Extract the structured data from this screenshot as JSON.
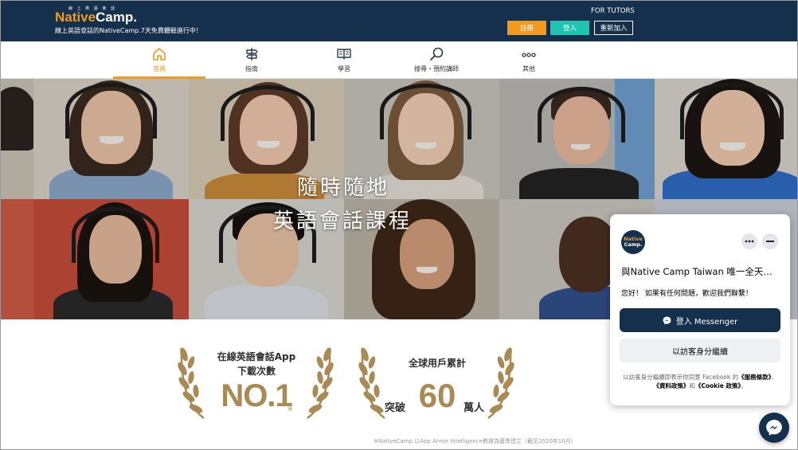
{
  "header": {
    "logo_small": "線 上 英 語 會 話",
    "logo_native": "Native",
    "logo_camp": "Camp.",
    "tagline": "線上英語會話的NativeCamp.7天免費體驗進行中！",
    "for_tutors": "FOR TUTORS",
    "register_label": "註冊",
    "login_label": "登入",
    "rejoin_label": "重新加入",
    "colors": {
      "navy": "#14304d",
      "orange": "#f39a1e",
      "teal": "#21c4b1"
    }
  },
  "nav": {
    "items": [
      {
        "label": "首頁",
        "icon": "home-icon",
        "active": true
      },
      {
        "label": "指南",
        "icon": "signpost-icon",
        "active": false
      },
      {
        "label": "學習",
        "icon": "book-icon",
        "active": false
      },
      {
        "label": "搜尋・預約講師",
        "icon": "search-icon",
        "active": false
      },
      {
        "label": "其他",
        "icon": "more-dots-icon",
        "active": false
      }
    ]
  },
  "hero": {
    "line1": "隨時隨地",
    "line2": "英語會話課程"
  },
  "awards": {
    "app": {
      "line1": "在線英語會話App",
      "line2": "下載次數",
      "rank": "NO.1",
      "mark": "※"
    },
    "users": {
      "line1": "全球用戶累計",
      "prefix": "突破",
      "number": "60",
      "suffix": "萬人"
    },
    "footnote": "※NativeCamp.以App Annie Intelligence數據為基準建立（截至2020年10月）"
  },
  "messenger": {
    "logo_native": "Native",
    "logo_camp": "Camp.",
    "more_icon": "more-horizontal-icon",
    "minimize_icon": "minimize-icon",
    "title": "與Native Camp Taiwan 唯一全天候客服線上交談",
    "greeting": "您好！ 如果有任何問題，歡迎我們聯繫！",
    "login_button": "登入 Messenger",
    "guest_button": "以訪客身分繼續",
    "terms_prefix": "以訪客身分繼續即表示你同意 Facebook 的",
    "terms_service": "《服務條款》",
    "terms_sep1": "、",
    "terms_data": "《資料政策》",
    "terms_and": "和",
    "terms_cookie": "《Cookie 政策》",
    "terms_end": "。"
  }
}
